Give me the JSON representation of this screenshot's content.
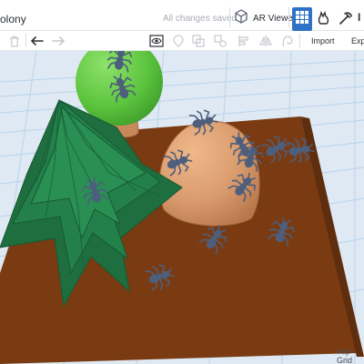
{
  "topbar": {
    "design_name": "olony",
    "save_status": "All changes saved",
    "ar_viewer_label": "AR Viewer",
    "cut_label": "I",
    "icons": [
      "ar-cube-icon",
      "grid-view-icon",
      "blocks-icon",
      "bricks-icon"
    ]
  },
  "toolbar": {
    "import_label": "Import",
    "export_label": "Expo",
    "icons": [
      "trash-icon",
      "undo-icon",
      "redo-icon",
      "view-eye-icon",
      "note-icon",
      "group-icon",
      "ungroup-icon",
      "align-icon",
      "mirror-icon",
      "hole-icon"
    ]
  },
  "viewport": {
    "snap_grid_label": "nap Grid",
    "colors": {
      "ground": "#7a3b12",
      "tree_dark": "#1f6e3f",
      "tree_light": "#5cc43e",
      "trunk": "#c9885a",
      "anthill": "#d89a6c",
      "ants": "#4d5f7c",
      "grid_line": "#b8d3ec",
      "toggle_active": "#2f73c7"
    }
  }
}
